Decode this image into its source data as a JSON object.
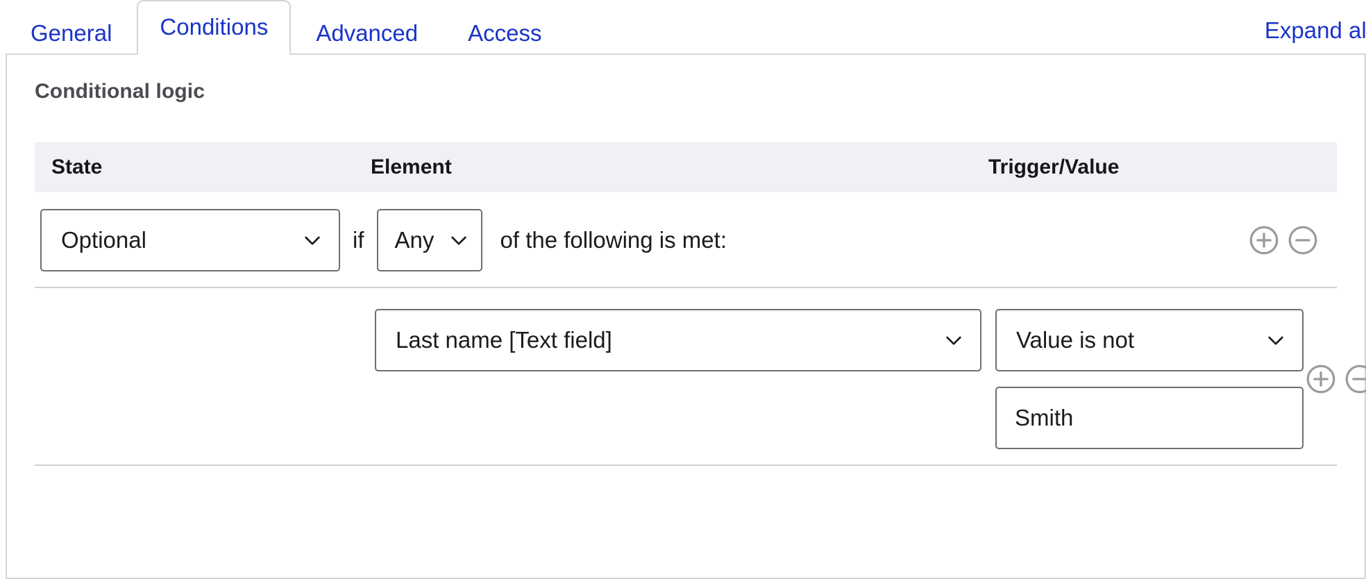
{
  "tabs": [
    {
      "label": "General",
      "active": false
    },
    {
      "label": "Conditions",
      "active": true
    },
    {
      "label": "Advanced",
      "active": false
    },
    {
      "label": "Access",
      "active": false
    }
  ],
  "toolbar": {
    "expand_all_label": "Expand all"
  },
  "panel": {
    "title": "Conditional logic"
  },
  "table": {
    "columns": {
      "state": "State",
      "element": "Element",
      "trigger_value": "Trigger/Value"
    },
    "state_row": {
      "state_select": "Optional",
      "if_label": "if",
      "any_select": "Any",
      "following_label": "of the following is met:",
      "add_label": "+",
      "remove_label": "−"
    },
    "rule_rows": [
      {
        "element_select": "Last name [Text field]",
        "trigger_select": "Value is not",
        "value_input": "Smith",
        "value_placeholder": "",
        "add_label": "+",
        "remove_label": "−"
      }
    ]
  },
  "colors": {
    "link": "#1a34c8",
    "header_band": "#f0f1f5",
    "border": "#d3d4d9",
    "field_border": "#6b6e75",
    "icon": "#9a9ca1",
    "title": "#4a4c52"
  }
}
